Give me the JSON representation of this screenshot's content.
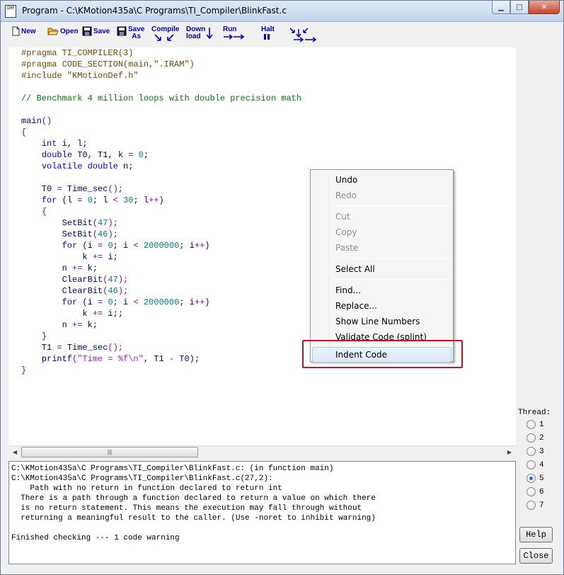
{
  "window": {
    "title": "Program - C:\\KMotion435a\\C Programs\\TI_Compiler\\BlinkFast.c",
    "app_icon_text": "DM",
    "buttons": [
      "minimize",
      "maximize",
      "close"
    ]
  },
  "toolbar": {
    "new": "New",
    "open": "Open",
    "save": "Save",
    "save_as": "Save\nAs",
    "compile": "Compile",
    "download": "Down\nload",
    "run": "Run",
    "halt": "Halt"
  },
  "code_lines": [
    [
      {
        "t": "#pragma TI_COMPILER(3)",
        "c": "pre"
      }
    ],
    [
      {
        "t": "#pragma CODE_SECTION(main,\".IRAM\")",
        "c": "pre"
      }
    ],
    [
      {
        "t": "#include \"KMotionDef.h\"",
        "c": "pre"
      }
    ],
    [],
    [
      {
        "t": "// Benchmark 4 million loops with double precision math",
        "c": "com"
      }
    ],
    [],
    [
      {
        "t": "main",
        "c": "txt"
      },
      {
        "t": "()",
        "c": "op"
      }
    ],
    [
      {
        "t": "{",
        "c": "op"
      }
    ],
    [
      {
        "t": "    "
      },
      {
        "t": "int",
        "c": "kw"
      },
      {
        "t": " i, l;",
        "c": "txt"
      }
    ],
    [
      {
        "t": "    "
      },
      {
        "t": "double",
        "c": "kw"
      },
      {
        "t": " T0, T1, k ",
        "c": "txt"
      },
      {
        "t": "=",
        "c": "op"
      },
      {
        "t": " "
      },
      {
        "t": "0",
        "c": "num"
      },
      {
        "t": ";",
        "c": "txt"
      }
    ],
    [
      {
        "t": "    "
      },
      {
        "t": "volatile double",
        "c": "kw"
      },
      {
        "t": " n;",
        "c": "txt"
      }
    ],
    [],
    [
      {
        "t": "    T0 ",
        "c": "txt"
      },
      {
        "t": "=",
        "c": "op"
      },
      {
        "t": " Time_sec",
        "c": "txt"
      },
      {
        "t": "();",
        "c": "op"
      }
    ],
    [
      {
        "t": "    "
      },
      {
        "t": "for",
        "c": "kw"
      },
      {
        "t": " (l ",
        "c": "txt"
      },
      {
        "t": "=",
        "c": "op"
      },
      {
        "t": " "
      },
      {
        "t": "0",
        "c": "num"
      },
      {
        "t": "; l ",
        "c": "txt"
      },
      {
        "t": "<",
        "c": "op"
      },
      {
        "t": " "
      },
      {
        "t": "30",
        "c": "num"
      },
      {
        "t": "; l",
        "c": "txt"
      },
      {
        "t": "++",
        "c": "op"
      },
      {
        "t": ")",
        "c": "txt"
      }
    ],
    [
      {
        "t": "    "
      },
      {
        "t": "{",
        "c": "op"
      }
    ],
    [
      {
        "t": "        SetBit",
        "c": "txt"
      },
      {
        "t": "(",
        "c": "op"
      },
      {
        "t": "47",
        "c": "num"
      },
      {
        "t": ");",
        "c": "op"
      }
    ],
    [
      {
        "t": "        SetBit",
        "c": "txt"
      },
      {
        "t": "(",
        "c": "op"
      },
      {
        "t": "46",
        "c": "num"
      },
      {
        "t": ");",
        "c": "op"
      }
    ],
    [
      {
        "t": "        "
      },
      {
        "t": "for",
        "c": "kw"
      },
      {
        "t": " (i ",
        "c": "txt"
      },
      {
        "t": "=",
        "c": "op"
      },
      {
        "t": " "
      },
      {
        "t": "0",
        "c": "num"
      },
      {
        "t": "; i ",
        "c": "txt"
      },
      {
        "t": "<",
        "c": "op"
      },
      {
        "t": " "
      },
      {
        "t": "2000000",
        "c": "num"
      },
      {
        "t": "; i",
        "c": "txt"
      },
      {
        "t": "++",
        "c": "op"
      },
      {
        "t": ")",
        "c": "txt"
      }
    ],
    [
      {
        "t": "            k ",
        "c": "txt"
      },
      {
        "t": "+=",
        "c": "op"
      },
      {
        "t": " i;",
        "c": "txt"
      }
    ],
    [
      {
        "t": "        n ",
        "c": "txt"
      },
      {
        "t": "+=",
        "c": "op"
      },
      {
        "t": " k;",
        "c": "txt"
      }
    ],
    [
      {
        "t": "        ClearBit",
        "c": "txt"
      },
      {
        "t": "(",
        "c": "op"
      },
      {
        "t": "47",
        "c": "num"
      },
      {
        "t": ");",
        "c": "op"
      }
    ],
    [
      {
        "t": "        ClearBit",
        "c": "txt"
      },
      {
        "t": "(",
        "c": "op"
      },
      {
        "t": "46",
        "c": "num"
      },
      {
        "t": ");",
        "c": "op"
      }
    ],
    [
      {
        "t": "        "
      },
      {
        "t": "for",
        "c": "kw"
      },
      {
        "t": " (i ",
        "c": "txt"
      },
      {
        "t": "=",
        "c": "op"
      },
      {
        "t": " "
      },
      {
        "t": "0",
        "c": "num"
      },
      {
        "t": "; i ",
        "c": "txt"
      },
      {
        "t": "<",
        "c": "op"
      },
      {
        "t": " "
      },
      {
        "t": "2000000",
        "c": "num"
      },
      {
        "t": "; i",
        "c": "txt"
      },
      {
        "t": "++",
        "c": "op"
      },
      {
        "t": ")",
        "c": "txt"
      }
    ],
    [
      {
        "t": "            k ",
        "c": "txt"
      },
      {
        "t": "+=",
        "c": "op"
      },
      {
        "t": " i;;",
        "c": "txt"
      }
    ],
    [
      {
        "t": "        n ",
        "c": "txt"
      },
      {
        "t": "+=",
        "c": "op"
      },
      {
        "t": " k;",
        "c": "txt"
      }
    ],
    [
      {
        "t": "    "
      },
      {
        "t": "}",
        "c": "op"
      }
    ],
    [
      {
        "t": "    T1 ",
        "c": "txt"
      },
      {
        "t": "=",
        "c": "op"
      },
      {
        "t": " Time_sec",
        "c": "txt"
      },
      {
        "t": "();",
        "c": "op"
      }
    ],
    [
      {
        "t": "    printf",
        "c": "txt"
      },
      {
        "t": "(",
        "c": "op"
      },
      {
        "t": "\"Time = %f\\n\"",
        "c": "str"
      },
      {
        "t": ", T1 ",
        "c": "txt"
      },
      {
        "t": "-",
        "c": "op"
      },
      {
        "t": " T0);",
        "c": "txt"
      }
    ],
    [
      {
        "t": "}",
        "c": "op"
      }
    ]
  ],
  "colors": {
    "pre": "#804000",
    "com": "#008000",
    "kw": "#0000ff",
    "num": "#008080",
    "str": "#a020f0",
    "op": "#a000a0",
    "txt": "#000080",
    "toolbar_text": "#0000c8",
    "highlight": "#c8102e"
  },
  "output": {
    "lines": [
      "C:\\KMotion435a\\C Programs\\TI_Compiler\\BlinkFast.c: (in function main)",
      "C:\\KMotion435a\\C Programs\\TI_Compiler\\BlinkFast.c(27,2):",
      "    Path with no return in function declared to return int",
      "  There is a path through a function declared to return a value on which there",
      "  is no return statement. This means the execution may fall through without",
      "  returning a meaningful result to the caller. (Use -noret to inhibit warning)",
      "",
      "Finished checking --- 1 code warning"
    ]
  },
  "thread": {
    "label": "Thread:",
    "options": [
      "1",
      "2",
      "3",
      "4",
      "5",
      "6",
      "7"
    ],
    "selected": "5"
  },
  "buttons": {
    "help": "Help",
    "close": "Close"
  },
  "context_menu": {
    "items": [
      {
        "label": "Undo",
        "enabled": true
      },
      {
        "label": "Redo",
        "enabled": false
      },
      {
        "sep": true
      },
      {
        "label": "Cut",
        "enabled": false
      },
      {
        "label": "Copy",
        "enabled": false
      },
      {
        "label": "Paste",
        "enabled": false
      },
      {
        "sep": true
      },
      {
        "label": "Select All",
        "enabled": true
      },
      {
        "sep": true
      },
      {
        "label": "Find...",
        "enabled": true
      },
      {
        "label": "Replace...",
        "enabled": true
      },
      {
        "label": "Show Line Numbers",
        "enabled": true
      },
      {
        "label": "Validate Code (splint)",
        "enabled": true
      },
      {
        "label": "Indent Code",
        "enabled": true,
        "hovered": true
      }
    ]
  }
}
